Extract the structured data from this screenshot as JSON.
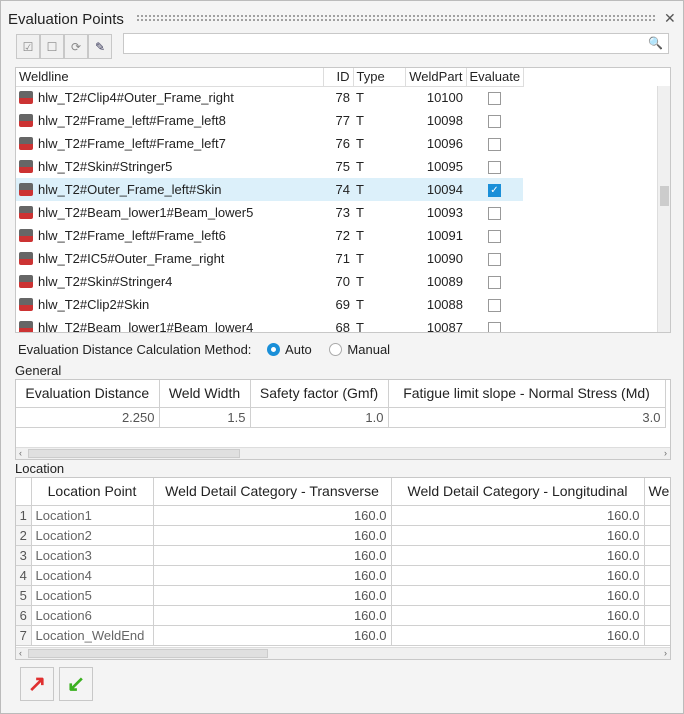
{
  "title": "Evaluation Points",
  "search": {
    "placeholder": ""
  },
  "weldlines": {
    "headers": [
      "Weldline",
      "ID",
      "Type",
      "WeldPart",
      "Evaluate"
    ],
    "rows": [
      {
        "name": "hlw_T2#Clip4#Outer_Frame_right",
        "id": "78",
        "type": "T",
        "part": "10100",
        "eval": false
      },
      {
        "name": "hlw_T2#Frame_left#Frame_left8",
        "id": "77",
        "type": "T",
        "part": "10098",
        "eval": false
      },
      {
        "name": "hlw_T2#Frame_left#Frame_left7",
        "id": "76",
        "type": "T",
        "part": "10096",
        "eval": false
      },
      {
        "name": "hlw_T2#Skin#Stringer5",
        "id": "75",
        "type": "T",
        "part": "10095",
        "eval": false
      },
      {
        "name": "hlw_T2#Outer_Frame_left#Skin",
        "id": "74",
        "type": "T",
        "part": "10094",
        "eval": true
      },
      {
        "name": "hlw_T2#Beam_lower1#Beam_lower5",
        "id": "73",
        "type": "T",
        "part": "10093",
        "eval": false
      },
      {
        "name": "hlw_T2#Frame_left#Frame_left6",
        "id": "72",
        "type": "T",
        "part": "10091",
        "eval": false
      },
      {
        "name": "hlw_T2#IC5#Outer_Frame_right",
        "id": "71",
        "type": "T",
        "part": "10090",
        "eval": false
      },
      {
        "name": "hlw_T2#Skin#Stringer4",
        "id": "70",
        "type": "T",
        "part": "10089",
        "eval": false
      },
      {
        "name": "hlw_T2#Clip2#Skin",
        "id": "69",
        "type": "T",
        "part": "10088",
        "eval": false
      },
      {
        "name": "hlw_T2#Beam_lower1#Beam_lower4",
        "id": "68",
        "type": "T",
        "part": "10087",
        "eval": false
      }
    ]
  },
  "method": {
    "label": "Evaluation Distance Calculation Method:",
    "auto": "Auto",
    "manual": "Manual",
    "selected": "Auto"
  },
  "general": {
    "label": "General",
    "headers": [
      "Evaluation Distance",
      "Weld Width",
      "Safety factor (Gmf)",
      "Fatigue limit slope - Normal Stress (Md)"
    ],
    "values": [
      "2.250",
      "1.5",
      "1.0",
      "3.0"
    ]
  },
  "location": {
    "label": "Location",
    "headers": [
      "",
      "Location Point",
      "Weld Detail Category - Transverse",
      "Weld Detail Category - Longitudinal",
      "We"
    ],
    "rows": [
      [
        "1",
        "Location1",
        "160.0",
        "160.0"
      ],
      [
        "2",
        "Location2",
        "160.0",
        "160.0"
      ],
      [
        "3",
        "Location3",
        "160.0",
        "160.0"
      ],
      [
        "4",
        "Location4",
        "160.0",
        "160.0"
      ],
      [
        "5",
        "Location5",
        "160.0",
        "160.0"
      ],
      [
        "6",
        "Location6",
        "160.0",
        "160.0"
      ],
      [
        "7",
        "Location_WeldEnd",
        "160.0",
        "160.0"
      ]
    ]
  }
}
